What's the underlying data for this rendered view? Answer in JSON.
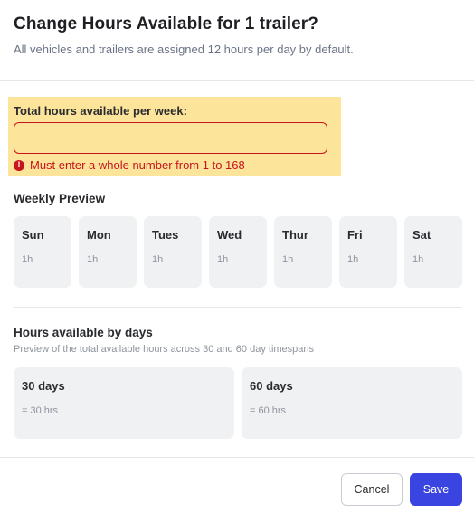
{
  "dialog": {
    "title": "Change Hours Available for 1 trailer?",
    "subtitle": "All vehicles and trailers are assigned 12 hours per day by default."
  },
  "field": {
    "label": "Total hours available per week:",
    "value": "",
    "placeholder": "",
    "error_icon": "exclamation-circle-icon",
    "error_icon_glyph": "!",
    "error": "Must enter a whole number from 1 to 168"
  },
  "weekly_preview": {
    "title": "Weekly Preview",
    "days": [
      {
        "name": "Sun",
        "hours": "1h"
      },
      {
        "name": "Mon",
        "hours": "1h"
      },
      {
        "name": "Tues",
        "hours": "1h"
      },
      {
        "name": "Wed",
        "hours": "1h"
      },
      {
        "name": "Thur",
        "hours": "1h"
      },
      {
        "name": "Fri",
        "hours": "1h"
      },
      {
        "name": "Sat",
        "hours": "1h"
      }
    ]
  },
  "hours_by_days": {
    "title": "Hours available by days",
    "description": "Preview of the total available hours across 30 and 60 day timespans",
    "spans": [
      {
        "name": "30 days",
        "hours": "= 30 hrs"
      },
      {
        "name": "60 days",
        "hours": "= 60 hrs"
      }
    ]
  },
  "footer": {
    "cancel_label": "Cancel",
    "save_label": "Save"
  },
  "colors": {
    "accent": "#3a44e0",
    "error": "#c8141b",
    "highlight": "#fde49b"
  }
}
